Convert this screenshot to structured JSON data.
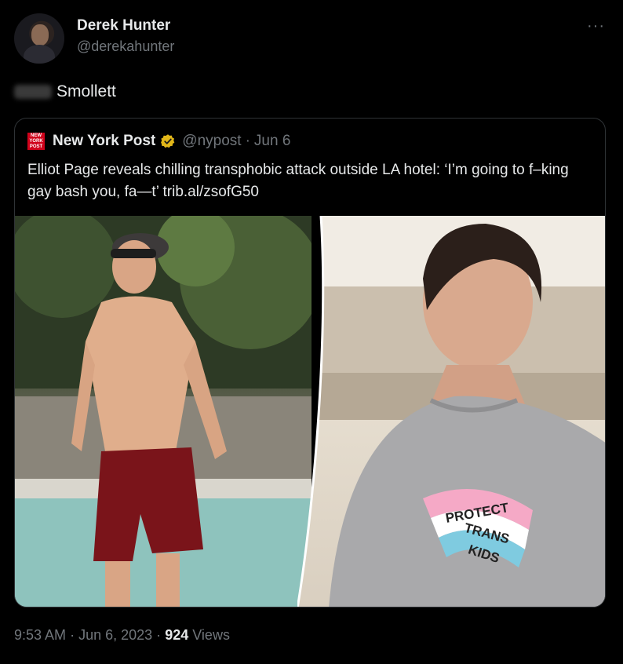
{
  "tweet": {
    "display_name": "Derek Hunter",
    "handle": "@derekahunter",
    "more_icon": "more-horizontal-icon",
    "text": "Smollett"
  },
  "quote": {
    "logo_text": "NEW YORK POST",
    "name": "New York Post",
    "handle": "@nypost",
    "separator": "·",
    "date": "Jun 6",
    "text": "Elliot Page reveals chilling transphobic attack outside LA hotel: ‘I’m going to f–king gay bash you, fa—t’ trib.al/zsofG50",
    "verified_color": "#e2b719",
    "logo_color": "#d0021b"
  },
  "media": {
    "shirt_text": [
      "PROTECT",
      "TRANS",
      "KIDS"
    ]
  },
  "footer": {
    "time": "9:53 AM",
    "separator": "·",
    "date": "Jun 6, 2023",
    "views_count": "924",
    "views_label": "Views"
  },
  "colors": {
    "background": "#000000",
    "text_primary": "#e7e9ea",
    "text_secondary": "#71767b",
    "border": "#2f3336"
  }
}
